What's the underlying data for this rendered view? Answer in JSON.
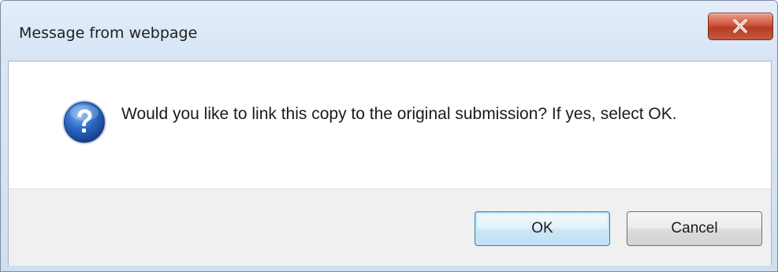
{
  "dialog": {
    "title": "Message from webpage",
    "close_glyph": "X",
    "icon": "question-icon",
    "message": "Would you like to link this copy to the original submission? If yes, select OK.",
    "buttons": {
      "ok_label": "OK",
      "cancel_label": "Cancel"
    },
    "colors": {
      "icon_blue": "#1f5fb8",
      "close_red": "#c9452e",
      "default_button_border": "#3c7fb1"
    }
  }
}
